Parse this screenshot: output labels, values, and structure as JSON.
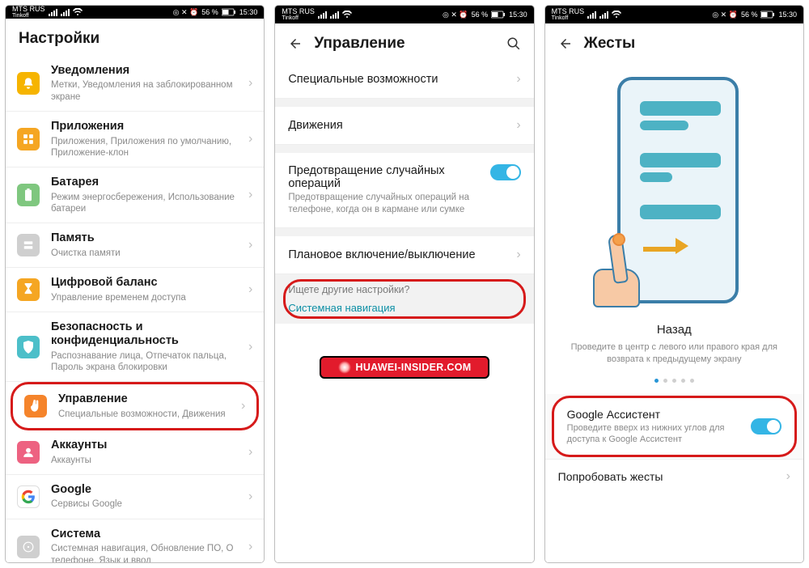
{
  "status_bar": {
    "carrier": "MTS RUS",
    "carrier_sub": "Tinkoff",
    "battery_text": "56 %",
    "time": "15:30"
  },
  "screen1": {
    "title": "Настройки",
    "items": [
      {
        "title": "Уведомления",
        "subtitle": "Метки, Уведомления на заблокированном экране"
      },
      {
        "title": "Приложения",
        "subtitle": "Приложения, Приложения по умолчанию, Приложение-клон"
      },
      {
        "title": "Батарея",
        "subtitle": "Режим энергосбережения, Использование батареи"
      },
      {
        "title": "Память",
        "subtitle": "Очистка памяти"
      },
      {
        "title": "Цифровой баланс",
        "subtitle": "Управление временем доступа"
      },
      {
        "title": "Безопасность и конфиденциальность",
        "subtitle": "Распознавание лица, Отпечаток пальца, Пароль экрана блокировки"
      },
      {
        "title": "Управление",
        "subtitle": "Специальные возможности, Движения"
      },
      {
        "title": "Аккаунты",
        "subtitle": "Аккаунты"
      },
      {
        "title": "Google",
        "subtitle": "Сервисы Google"
      },
      {
        "title": "Система",
        "subtitle": "Системная навигация, Обновление ПО, О телефоне, Язык и ввод"
      }
    ]
  },
  "screen2": {
    "title": "Управление",
    "rows": {
      "accessibility": "Специальные возможности",
      "motions": "Движения",
      "prevent_title": "Предотвращение случайных операций",
      "prevent_sub": "Предотвращение случайных операций на телефоне, когда он в кармане или сумке",
      "scheduled": "Плановое включение/выключение"
    },
    "hint_q": "Ищете другие настройки?",
    "hint_link": "Системная навигация",
    "watermark": "HUAWEI-INSIDER.COM"
  },
  "screen3": {
    "title": "Жесты",
    "illus_title": "Назад",
    "illus_sub": "Проведите в центр с левого или правого края для возврата к предыдущему экрану",
    "assistant_title": "Google Ассистент",
    "assistant_sub": "Проведите вверх из нижних углов для доступа к Google Ассистент",
    "try_row": "Попробовать жесты"
  }
}
